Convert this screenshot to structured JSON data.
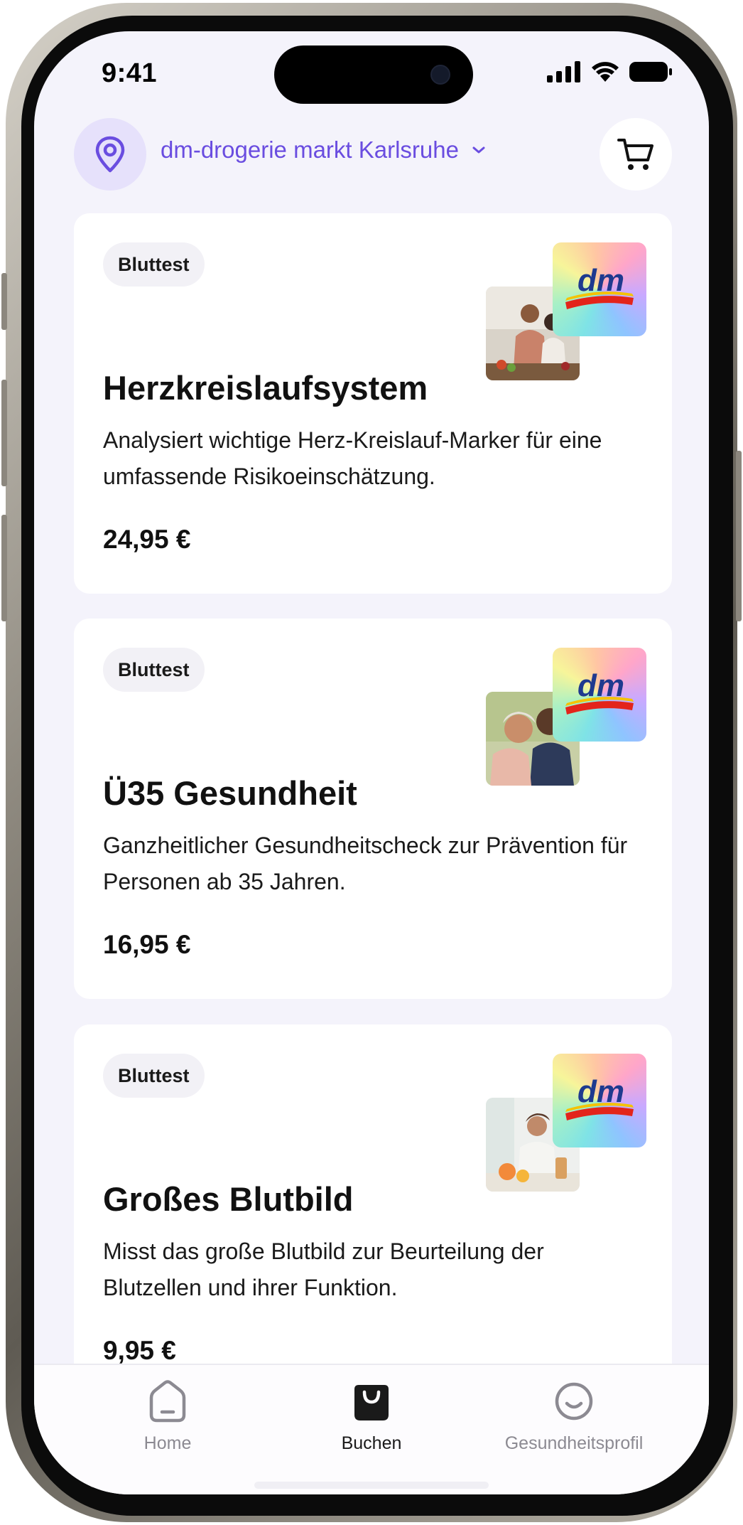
{
  "status_bar": {
    "time": "9:41"
  },
  "header": {
    "store_name": "dm-drogerie markt Karlsruhe",
    "icons": {
      "location": "location-pin-icon",
      "dropdown": "chevron-down-icon",
      "cart": "cart-icon"
    }
  },
  "cards": [
    {
      "badge": "Bluttest",
      "title": "Herzkreislaufsystem",
      "description": "Analysiert wichtige Herz-Kreislauf-Marker für eine umfassende Risikoeinschätzung.",
      "price": "24,95 €",
      "logo_text": "dm"
    },
    {
      "badge": "Bluttest",
      "title": "Ü35 Gesundheit",
      "description": "Ganzheitlicher Gesundheitscheck zur Prävention für Personen ab 35 Jahren.",
      "price": "16,95 €",
      "logo_text": "dm"
    },
    {
      "badge": "Bluttest",
      "title": "Großes Blutbild",
      "description": "Misst das große Blutbild zur Beurteilung der Blutzellen und ihrer Funktion.",
      "price": "9,95 €",
      "logo_text": "dm"
    }
  ],
  "tabbar": {
    "tabs": [
      {
        "label": "Home",
        "icon": "home-icon",
        "active": false
      },
      {
        "label": "Buchen",
        "icon": "shopping-bag-icon",
        "active": true
      },
      {
        "label": "Gesundheitsprofil",
        "icon": "smiley-icon",
        "active": false
      }
    ]
  },
  "colors": {
    "accent": "#6A4DE0",
    "accent_bg": "#E6E1FB",
    "screen_bg": "#F4F3FB",
    "card_bg": "#FFFFFF",
    "badge_bg": "#F2F1F6",
    "tab_inactive": "#8C8A92"
  }
}
